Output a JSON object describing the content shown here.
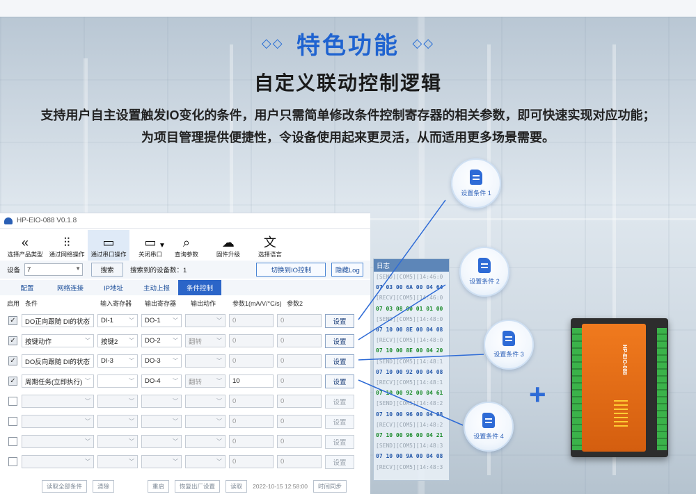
{
  "header": {
    "deco_left": "◇◇",
    "title": "特色功能",
    "deco_right": "◇◇",
    "subtitle": "自定义联动控制逻辑",
    "desc_line1": "支持用户自主设置触发IO变化的条件，用户只需简单修改条件控制寄存器的相关参数，即可快速实现对应功能；",
    "desc_line2": "为项目管理提供便捷性，令设备使用起来更灵活，从而适用更多场景需要。"
  },
  "app": {
    "window_title": "HP-EIO-088 V0.1.8",
    "toolbar": [
      {
        "label": "选择产品类型",
        "icon": "chevrons-left-icon"
      },
      {
        "label": "通过网络操作",
        "icon": "sliders-icon"
      },
      {
        "label": "通过串口操作",
        "icon": "serial-port-icon"
      },
      {
        "label": "关闭串口",
        "icon": "serial-port-icon"
      },
      {
        "label": "查询参数",
        "icon": "search-doc-icon"
      },
      {
        "label": "固件升级",
        "icon": "cloud-upload-icon"
      },
      {
        "label": "选择语言",
        "icon": "language-icon"
      }
    ],
    "device_label": "设备",
    "device_value": "7",
    "search_button": "搜索",
    "found_text": "搜索到的设备数：1",
    "switch_button": "切换到IO控制",
    "hide_log_button": "隐藏Log",
    "tabs": [
      "配置",
      "网络连接",
      "IP地址",
      "主动上报",
      "条件控制"
    ],
    "active_tab": "条件控制",
    "columns": [
      "启用",
      "条件",
      "输入寄存器",
      "输出寄存器",
      "输出动作",
      "参数1(mA/V/°C/s)",
      "参数2"
    ],
    "rows": [
      {
        "enabled": true,
        "cond": "DO正向跟随 DI的状态",
        "in": "DI-1",
        "out": "DO-1",
        "action": "",
        "p1": "0",
        "p2": "0",
        "btn": "设置"
      },
      {
        "enabled": true,
        "cond": "按键动作",
        "in": "按键2",
        "out": "DO-2",
        "action": "翻转",
        "p1": "0",
        "p2": "0",
        "btn": "设置"
      },
      {
        "enabled": true,
        "cond": "DO反向跟随 DI的状态",
        "in": "DI-3",
        "out": "DO-3",
        "action": "",
        "p1": "0",
        "p2": "0",
        "btn": "设置"
      },
      {
        "enabled": true,
        "cond": "周期任务(立即执行)",
        "in": "",
        "out": "DO-4",
        "action": "翻转",
        "p1": "10",
        "p2": "0",
        "btn": "设置"
      },
      {
        "enabled": false,
        "cond": "",
        "in": "",
        "out": "",
        "action": "",
        "p1": "0",
        "p2": "0",
        "btn": "设置"
      },
      {
        "enabled": false,
        "cond": "",
        "in": "",
        "out": "",
        "action": "",
        "p1": "0",
        "p2": "0",
        "btn": "设置"
      },
      {
        "enabled": false,
        "cond": "",
        "in": "",
        "out": "",
        "action": "",
        "p1": "0",
        "p2": "0",
        "btn": "设置"
      },
      {
        "enabled": false,
        "cond": "",
        "in": "",
        "out": "",
        "action": "",
        "p1": "0",
        "p2": "0",
        "btn": "设置"
      }
    ],
    "footer": [
      "读取全部条件",
      "清除",
      "重启",
      "恢复出厂设置",
      "读取",
      "2022-10-15 12:58:00",
      "时间同步"
    ]
  },
  "log": {
    "title": "日志",
    "lines": [
      {
        "t": "[SEND][COM5][14:46:0",
        "c": "s"
      },
      {
        "t": "07 03 00 6A 00 04 64",
        "c": "b"
      },
      {
        "t": "[RECV][COM5][14:46:0",
        "c": "s"
      },
      {
        "t": "07 03 08 00 01 01 00",
        "c": "g"
      },
      {
        "t": "[SEND][COM5][14:48:0",
        "c": "s"
      },
      {
        "t": "07 10 00 8E 00 04 08",
        "c": "b"
      },
      {
        "t": "[RECV][COM5][14:48:0",
        "c": "s"
      },
      {
        "t": "07 10 00 8E 00 04 20",
        "c": "g"
      },
      {
        "t": "[SEND][COM5][14:48:1",
        "c": "s"
      },
      {
        "t": "07 10 00 92 00 04 08",
        "c": "b"
      },
      {
        "t": "[RECV][COM5][14:48:1",
        "c": "s"
      },
      {
        "t": "07 10 00 92 00 04 61",
        "c": "g"
      },
      {
        "t": "[SEND][COM5][14:48:2",
        "c": "s"
      },
      {
        "t": "07 10 00 96 00 04 08",
        "c": "b"
      },
      {
        "t": "[RECV][COM5][14:48:2",
        "c": "s"
      },
      {
        "t": "07 10 00 96 00 04 21",
        "c": "g"
      },
      {
        "t": "[SEND][COM5][14:48:3",
        "c": "s"
      },
      {
        "t": "07 10 00 9A 00 04 08",
        "c": "b"
      },
      {
        "t": "[RECV][COM5][14:48:3",
        "c": "s"
      }
    ]
  },
  "bubbles": [
    "设置条件 1",
    "设置条件 2",
    "设置条件 3",
    "设置条件 4"
  ],
  "device": {
    "label": "HP-EIO-088"
  },
  "plus": "+",
  "colors": {
    "accent": "#1f63d0",
    "tab_active": "#2b65c8",
    "device_orange": "#f07a1e",
    "log_green": "#1a8a2a"
  }
}
